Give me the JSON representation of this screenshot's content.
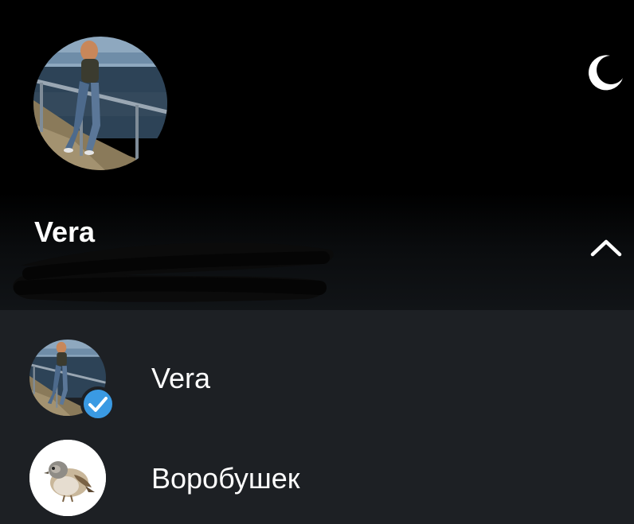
{
  "header": {
    "profile_name": "Vera",
    "phone": "",
    "night_mode_icon": "moon-icon",
    "expand_icon": "chevron-up-icon"
  },
  "accounts": [
    {
      "name": "Vera",
      "selected": true,
      "avatar": "photo",
      "badge_icon": "check-icon"
    },
    {
      "name": "Воробушек",
      "selected": false,
      "avatar": "sparrow-illustration"
    }
  ],
  "colors": {
    "header_bg": "#000000",
    "list_bg": "#1d2024",
    "text": "#ffffff",
    "badge_accent": "#3a9ae3"
  }
}
